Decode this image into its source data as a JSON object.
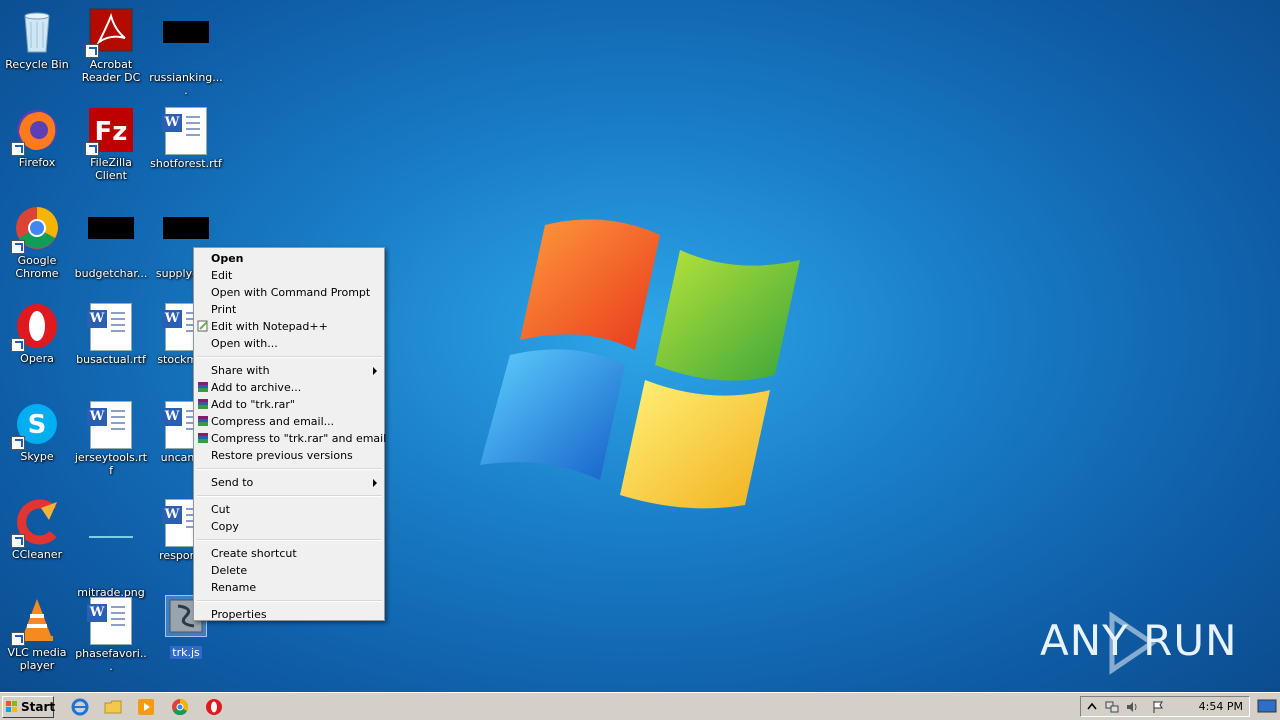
{
  "desktop": {
    "icons": [
      {
        "label": "Recycle Bin"
      },
      {
        "label": "Acrobat Reader DC"
      },
      {
        "label": "russianking...."
      },
      {
        "label": "Firefox"
      },
      {
        "label": "FileZilla Client"
      },
      {
        "label": "shotforest.rtf"
      },
      {
        "label": "Google Chrome"
      },
      {
        "label": "budgetchar..."
      },
      {
        "label": "supplydo..."
      },
      {
        "label": "Opera"
      },
      {
        "label": "busactual.rtf"
      },
      {
        "label": "stockmu..."
      },
      {
        "label": "Skype"
      },
      {
        "label": "jerseytools.rtf"
      },
      {
        "label": "uncano..."
      },
      {
        "label": "CCleaner"
      },
      {
        "label": "mitrade.png"
      },
      {
        "label": "respons..."
      },
      {
        "label": "VLC media player"
      },
      {
        "label": "phasefavori..."
      },
      {
        "label": "trk.js"
      }
    ]
  },
  "context_menu": {
    "items": [
      {
        "label": "Open"
      },
      {
        "label": "Edit"
      },
      {
        "label": "Open with Command Prompt"
      },
      {
        "label": "Print"
      },
      {
        "label": "Edit with Notepad++"
      },
      {
        "label": "Open with..."
      },
      {
        "label": "Share with"
      },
      {
        "label": "Add to archive..."
      },
      {
        "label": "Add to \"trk.rar\""
      },
      {
        "label": "Compress and email..."
      },
      {
        "label": "Compress to \"trk.rar\" and email"
      },
      {
        "label": "Restore previous versions"
      },
      {
        "label": "Send to"
      },
      {
        "label": "Cut"
      },
      {
        "label": "Copy"
      },
      {
        "label": "Create shortcut"
      },
      {
        "label": "Delete"
      },
      {
        "label": "Rename"
      },
      {
        "label": "Properties"
      }
    ]
  },
  "taskbar": {
    "start_label": "Start",
    "clock": "4:54 PM"
  },
  "watermark": {
    "text": "ANY RUN"
  }
}
